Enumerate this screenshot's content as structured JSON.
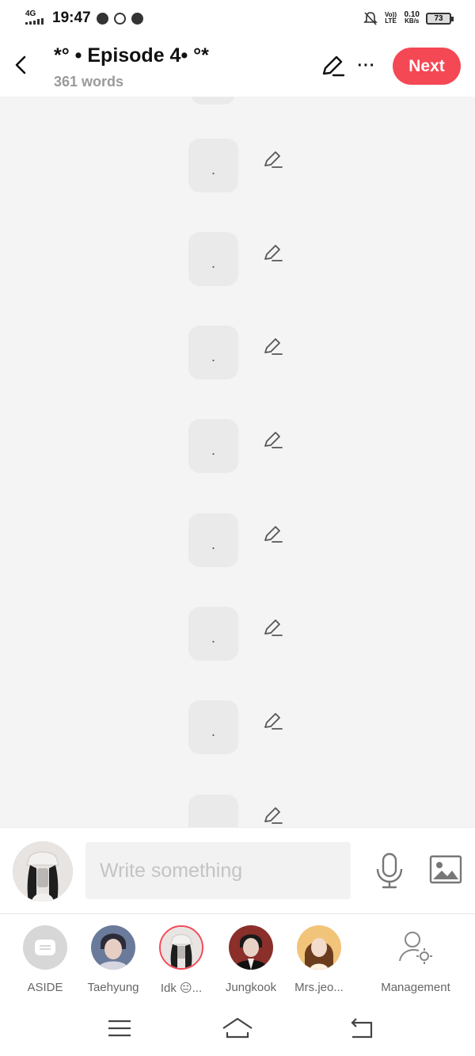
{
  "status_bar": {
    "network": "4G",
    "time": "19:47",
    "volte": "Vo)) LTE",
    "speed": "0.10",
    "speed_unit": "KB/s",
    "battery": "73"
  },
  "header": {
    "title": "*° • Episode 4• °*",
    "word_count": "361 words",
    "more_label": "···",
    "next_label": "Next"
  },
  "messages": [
    {
      "text": "."
    },
    {
      "text": "."
    },
    {
      "text": "."
    },
    {
      "text": "."
    },
    {
      "text": "."
    },
    {
      "text": "."
    },
    {
      "text": "."
    },
    {
      "text": ""
    }
  ],
  "composer": {
    "placeholder": "Write something"
  },
  "characters": [
    {
      "name": "ASIDE",
      "icon": "aside-icon"
    },
    {
      "name": "Taehyung",
      "icon": "avatar"
    },
    {
      "name": "Idk 😐...",
      "icon": "avatar",
      "selected": true
    },
    {
      "name": "Jungkook",
      "icon": "avatar"
    },
    {
      "name": "Mrs.jeo...",
      "icon": "avatar"
    },
    {
      "name": "Management",
      "icon": "management-icon"
    }
  ],
  "colors": {
    "accent": "#f44855",
    "background": "#f4f4f4",
    "bubble": "#eaeaea"
  }
}
